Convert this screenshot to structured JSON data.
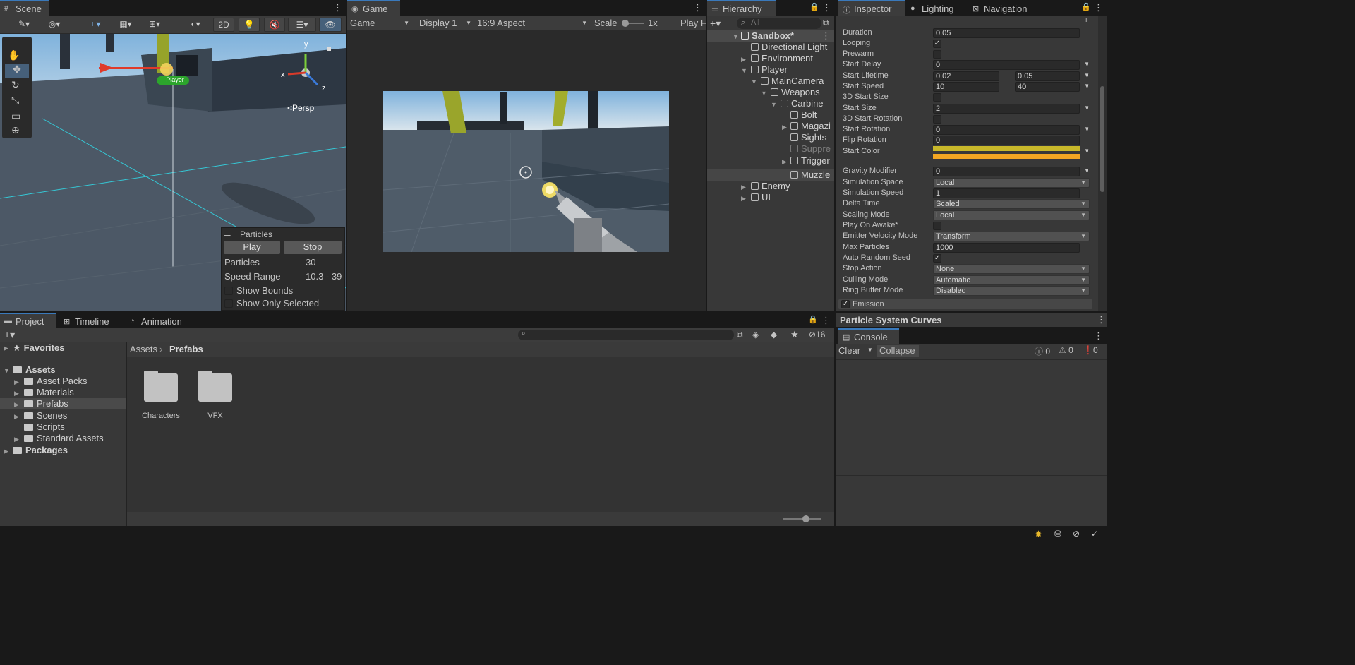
{
  "scene": {
    "tab": "Scene",
    "toolbar_2d": "2D",
    "gizmo_y": "y",
    "gizmo_x": "x",
    "gizmo_z": "z",
    "persp": "<Persp",
    "player_label": "Player"
  },
  "particles_overlay": {
    "title": "Particles",
    "play": "Play",
    "stop": "Stop",
    "particles_label": "Particles",
    "particles_value": "30",
    "speed_label": "Speed Range",
    "speed_value": "10.3 - 39",
    "show_bounds": "Show Bounds",
    "show_only_selected": "Show Only Selected"
  },
  "game": {
    "tab": "Game",
    "mode": "Game",
    "display": "Display 1",
    "aspect": "16:9 Aspect",
    "scale_label": "Scale",
    "scale_value": "1x",
    "play_focus": "Play F"
  },
  "hierarchy": {
    "tab": "Hierarchy",
    "search_placeholder": "All",
    "items": [
      {
        "label": "Sandbox*"
      },
      {
        "label": "Directional Light"
      },
      {
        "label": "Environment"
      },
      {
        "label": "Player"
      },
      {
        "label": "MainCamera"
      },
      {
        "label": "Weapons"
      },
      {
        "label": "Carbine"
      },
      {
        "label": "Bolt"
      },
      {
        "label": "Magazi"
      },
      {
        "label": "Sights"
      },
      {
        "label": "Suppre"
      },
      {
        "label": "Trigger"
      },
      {
        "label": "Muzzle"
      },
      {
        "label": "Enemy"
      },
      {
        "label": "UI"
      }
    ]
  },
  "inspector": {
    "tabs": [
      "Inspector",
      "Lighting",
      "Navigation"
    ],
    "rows": [
      {
        "label": "Duration",
        "value": "0.05"
      },
      {
        "label": "Looping",
        "value": "✓"
      },
      {
        "label": "Prewarm",
        "value": ""
      },
      {
        "label": "Start Delay",
        "value": "0"
      },
      {
        "label": "Start Lifetime",
        "value": "0.02",
        "value2": "0.05"
      },
      {
        "label": "Start Speed",
        "value": "10",
        "value2": "40"
      },
      {
        "label": "3D Start Size",
        "value": ""
      },
      {
        "label": "Start Size",
        "value": "2"
      },
      {
        "label": "3D Start Rotation",
        "value": ""
      },
      {
        "label": "Start Rotation",
        "value": "0"
      },
      {
        "label": "Flip Rotation",
        "value": "0"
      },
      {
        "label": "Start Color",
        "value": ""
      },
      {
        "label": "Gravity Modifier",
        "value": "0"
      },
      {
        "label": "Simulation Space",
        "value": "Local"
      },
      {
        "label": "Simulation Speed",
        "value": "1"
      },
      {
        "label": "Delta Time",
        "value": "Scaled"
      },
      {
        "label": "Scaling Mode",
        "value": "Local"
      },
      {
        "label": "Play On Awake*",
        "value": ""
      },
      {
        "label": "Emitter Velocity Mode",
        "value": "Transform"
      },
      {
        "label": "Max Particles",
        "value": "1000"
      },
      {
        "label": "Auto Random Seed",
        "value": "✓"
      },
      {
        "label": "Stop Action",
        "value": "None"
      },
      {
        "label": "Culling Mode",
        "value": "Automatic"
      },
      {
        "label": "Ring Buffer Mode",
        "value": "Disabled"
      }
    ],
    "emission": "Emission",
    "start_color_a": "#c8b82a",
    "start_color_b": "#f2a623"
  },
  "curves": {
    "title": "Particle System Curves"
  },
  "console": {
    "tab": "Console",
    "clear": "Clear",
    "collapse": "Collapse",
    "info_count": "0",
    "warn_count": "0",
    "error_count": "0"
  },
  "project": {
    "tabs": [
      "Project",
      "Timeline",
      "Animation"
    ],
    "hidden_count": "16",
    "favorites": "Favorites",
    "assets": "Assets",
    "tree": [
      "Asset Packs",
      "Materials",
      "Prefabs",
      "Scenes",
      "Scripts",
      "Standard Assets"
    ],
    "packages": "Packages",
    "breadcrumb_root": "Assets",
    "breadcrumb_current": "Prefabs",
    "folders": [
      "Characters",
      "VFX"
    ]
  }
}
